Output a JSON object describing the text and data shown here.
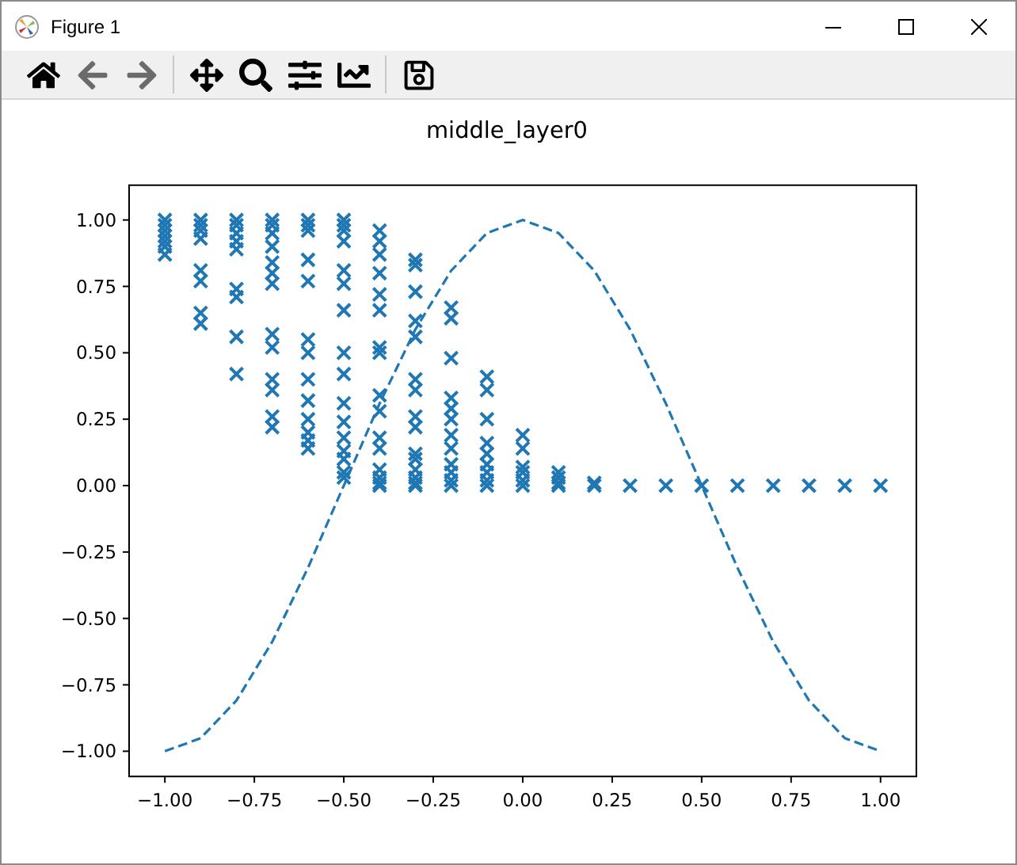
{
  "window": {
    "title": "Figure 1"
  },
  "toolbar": [
    {
      "kind": "home",
      "disabled": false
    },
    {
      "kind": "back",
      "disabled": true
    },
    {
      "kind": "forward",
      "disabled": true
    },
    {
      "kind": "separator"
    },
    {
      "kind": "pan",
      "disabled": false
    },
    {
      "kind": "zoom",
      "disabled": false
    },
    {
      "kind": "configure",
      "disabled": false
    },
    {
      "kind": "edit",
      "disabled": false
    },
    {
      "kind": "separator"
    },
    {
      "kind": "save",
      "disabled": false
    }
  ],
  "figure": {
    "chart_data": {
      "type": "line",
      "title": "middle_layer0",
      "xlim": [
        -1.1,
        1.1
      ],
      "ylim": [
        -1.095,
        1.131
      ],
      "xticks": [
        {
          "value": -1,
          "label": "−1.00"
        },
        {
          "value": -0.75,
          "label": "−0.75"
        },
        {
          "value": -0.5,
          "label": "−0.50"
        },
        {
          "value": -0.25,
          "label": "−0.25"
        },
        {
          "value": 0,
          "label": "0.00"
        },
        {
          "value": 0.25,
          "label": "0.25"
        },
        {
          "value": 0.5,
          "label": "0.50"
        },
        {
          "value": 0.75,
          "label": "0.75"
        },
        {
          "value": 1,
          "label": "1.00"
        }
      ],
      "yticks": [
        {
          "value": -1,
          "label": "−1.00"
        },
        {
          "value": -0.75,
          "label": "−0.75"
        },
        {
          "value": -0.5,
          "label": "−0.50"
        },
        {
          "value": -0.25,
          "label": "−0.25"
        },
        {
          "value": 0,
          "label": "0.00"
        },
        {
          "value": 0.25,
          "label": "0.25"
        },
        {
          "value": 0.5,
          "label": "0.50"
        },
        {
          "value": 0.75,
          "label": "0.75"
        },
        {
          "value": 1,
          "label": "1.00"
        }
      ],
      "series": [
        {
          "type": "line",
          "color": "#1f77b4",
          "line_style": "dashed",
          "x": [
            -1,
            -0.9,
            -0.8,
            -0.7,
            -0.6,
            -0.5,
            -0.4,
            -0.3,
            -0.2,
            -0.1,
            0,
            0.1,
            0.2,
            0.3,
            0.4,
            0.5,
            0.6,
            0.7,
            0.8,
            0.9,
            1
          ],
          "values": [
            -1,
            -0.951,
            -0.809,
            -0.588,
            -0.309,
            0,
            0.309,
            0.588,
            0.809,
            0.951,
            1,
            0.951,
            0.809,
            0.588,
            0.309,
            0,
            -0.309,
            -0.588,
            -0.809,
            -0.951,
            -1
          ]
        },
        {
          "type": "scatter",
          "color": "#1f77b4",
          "marker": "x",
          "x": [
            -1,
            -1,
            -1,
            -1,
            -1,
            -1,
            -1,
            -0.9,
            -0.9,
            -0.9,
            -0.9,
            -0.9,
            -0.9,
            -0.9,
            -0.9,
            -0.8,
            -0.8,
            -0.8,
            -0.8,
            -0.8,
            -0.8,
            -0.8,
            -0.8,
            -0.8,
            -0.7,
            -0.7,
            -0.7,
            -0.7,
            -0.7,
            -0.7,
            -0.7,
            -0.7,
            -0.7,
            -0.7,
            -0.7,
            -0.7,
            -0.7,
            -0.6,
            -0.6,
            -0.6,
            -0.6,
            -0.6,
            -0.6,
            -0.6,
            -0.6,
            -0.6,
            -0.6,
            -0.6,
            -0.6,
            -0.6,
            -0.5,
            -0.5,
            -0.5,
            -0.5,
            -0.5,
            -0.5,
            -0.5,
            -0.5,
            -0.5,
            -0.5,
            -0.5,
            -0.5,
            -0.5,
            -0.5,
            -0.5,
            -0.5,
            -0.4,
            -0.4,
            -0.4,
            -0.4,
            -0.4,
            -0.4,
            -0.4,
            -0.4,
            -0.4,
            -0.4,
            -0.4,
            -0.4,
            -0.4,
            -0.4,
            -0.4,
            -0.4,
            -0.3,
            -0.3,
            -0.3,
            -0.3,
            -0.3,
            -0.3,
            -0.3,
            -0.3,
            -0.3,
            -0.3,
            -0.3,
            -0.3,
            -0.3,
            -0.3,
            -0.3,
            -0.2,
            -0.2,
            -0.2,
            -0.2,
            -0.2,
            -0.2,
            -0.2,
            -0.2,
            -0.2,
            -0.2,
            -0.2,
            -0.2,
            -0.1,
            -0.1,
            -0.1,
            -0.1,
            -0.1,
            -0.1,
            -0.1,
            -0.1,
            -0.1,
            0,
            0,
            0,
            0,
            0,
            0,
            0.1,
            0.1,
            0.1,
            0.1,
            0.2,
            0.2,
            0.3,
            0.4,
            0.5,
            0.6,
            0.7,
            0.8,
            0.9,
            1
          ],
          "values": [
            1,
            0.98,
            0.96,
            0.94,
            0.92,
            0.9,
            0.87,
            1,
            0.98,
            0.96,
            0.93,
            0.81,
            0.77,
            0.65,
            0.61,
            1,
            0.98,
            0.95,
            0.92,
            0.89,
            0.74,
            0.71,
            0.56,
            0.42,
            1,
            0.98,
            0.95,
            0.9,
            0.84,
            0.8,
            0.76,
            0.57,
            0.52,
            0.4,
            0.36,
            0.26,
            0.22,
            1,
            0.98,
            0.96,
            0.85,
            0.77,
            0.55,
            0.5,
            0.4,
            0.32,
            0.25,
            0.2,
            0.17,
            0.14,
            1,
            0.98,
            0.96,
            0.92,
            0.81,
            0.76,
            0.66,
            0.5,
            0.42,
            0.31,
            0.24,
            0.18,
            0.13,
            0.1,
            0.05,
            0.03,
            0.96,
            0.92,
            0.87,
            0.8,
            0.72,
            0.66,
            0.52,
            0.5,
            0.34,
            0.28,
            0.18,
            0.14,
            0.06,
            0.03,
            0.01,
            0,
            0.85,
            0.83,
            0.73,
            0.62,
            0.56,
            0.4,
            0.36,
            0.26,
            0.22,
            0.12,
            0.1,
            0.06,
            0.03,
            0.01,
            0,
            0.67,
            0.63,
            0.48,
            0.33,
            0.29,
            0.25,
            0.19,
            0.14,
            0.08,
            0.05,
            0.02,
            0,
            0.41,
            0.36,
            0.25,
            0.16,
            0.12,
            0.08,
            0.05,
            0.02,
            0,
            0.19,
            0.14,
            0.07,
            0.05,
            0.02,
            0,
            0.05,
            0.03,
            0.01,
            0,
            0.01,
            0,
            0,
            0,
            0,
            0,
            0,
            0,
            0,
            0
          ]
        }
      ]
    }
  }
}
